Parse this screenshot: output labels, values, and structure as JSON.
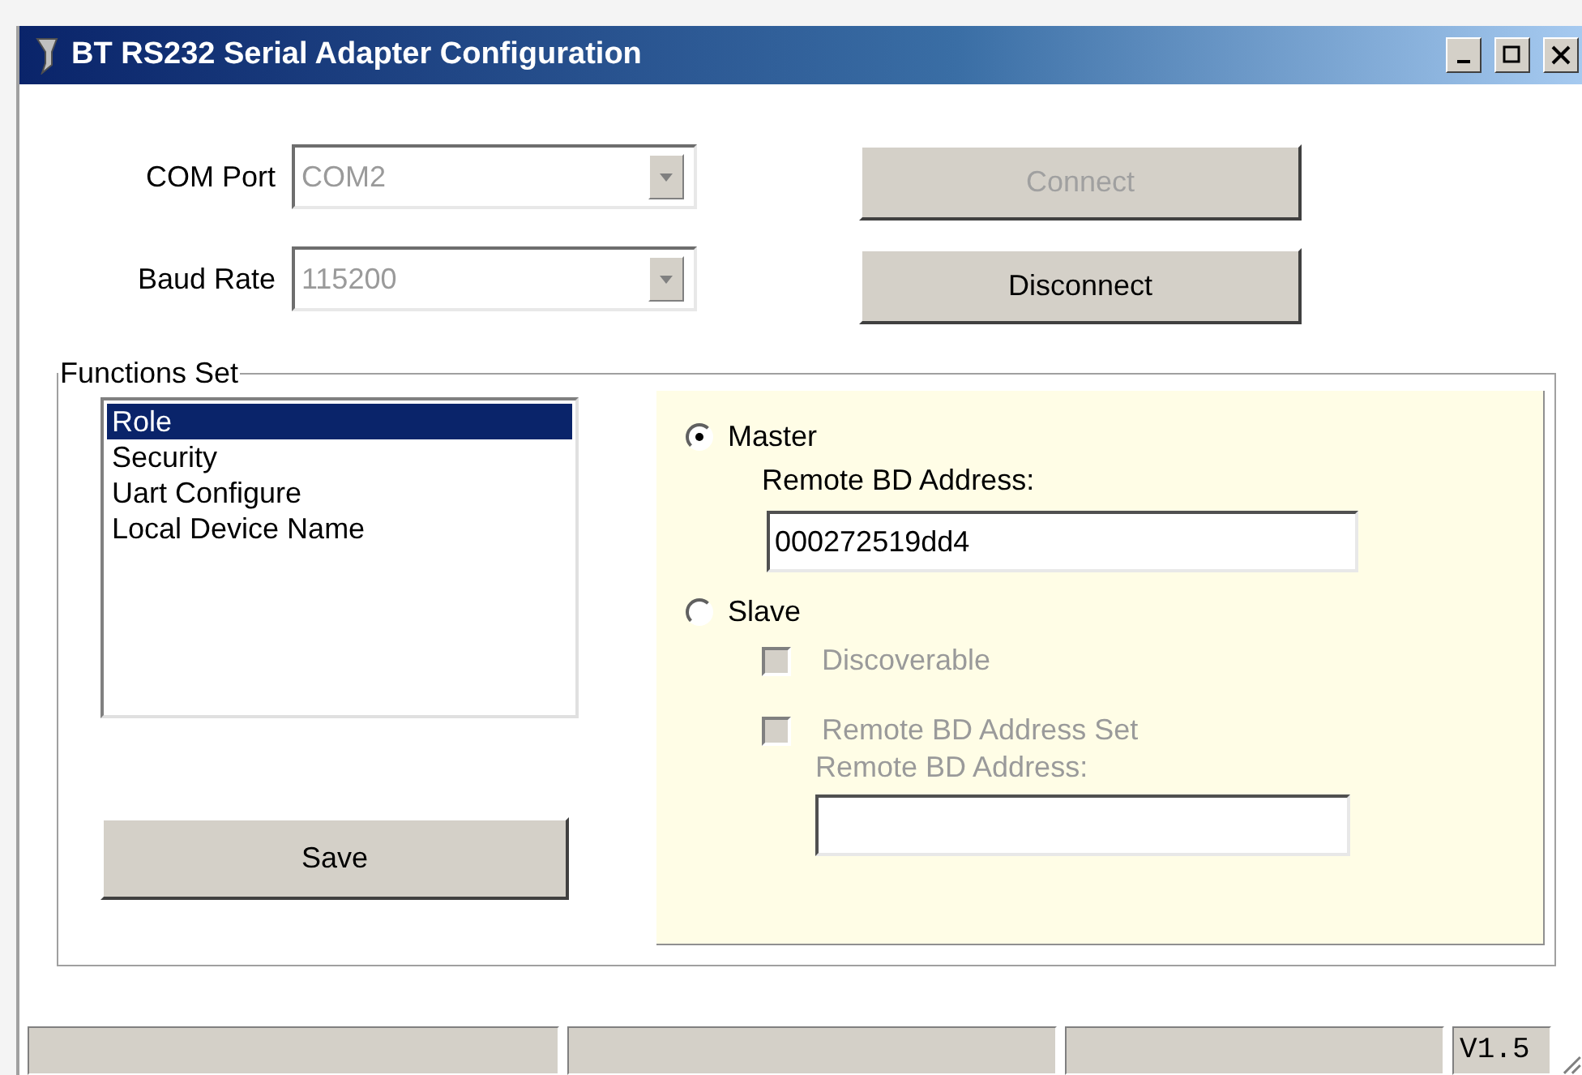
{
  "window": {
    "title": "BT RS232 Serial Adapter Configuration"
  },
  "connection": {
    "fields": [
      {
        "label": "COM Port",
        "value": "COM2",
        "disabled": true
      },
      {
        "label": "Baud Rate",
        "value": "115200",
        "disabled": true
      }
    ],
    "buttons": [
      {
        "label": "Connect",
        "disabled": true
      },
      {
        "label": "Disconnect",
        "disabled": false
      }
    ]
  },
  "functions_set": {
    "title": "Functions Set",
    "items": [
      {
        "label": "Role",
        "selected": true
      },
      {
        "label": "Security",
        "selected": false
      },
      {
        "label": "Uart Configure",
        "selected": false
      },
      {
        "label": "Local Device Name",
        "selected": false
      }
    ],
    "save_button": "Save"
  },
  "role": {
    "master": {
      "label": "Master",
      "selected": true,
      "address_label": "Remote BD Address:",
      "address_value": "000272519dd4"
    },
    "slave": {
      "label": "Slave",
      "selected": false,
      "checkboxes": [
        {
          "label": "Discoverable",
          "checked": false,
          "disabled": true
        },
        {
          "label": "Remote BD Address Set",
          "checked": false,
          "disabled": true
        }
      ],
      "address_label": "Remote BD Address:",
      "address_disabled": true
    }
  },
  "status_bar": {
    "version": "V1.5"
  }
}
